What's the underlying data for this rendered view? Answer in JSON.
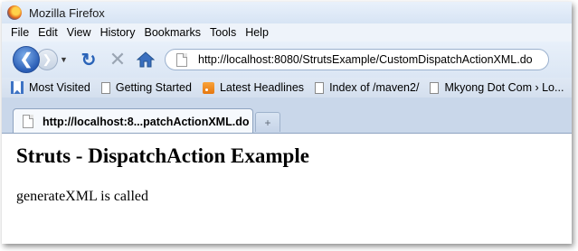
{
  "window": {
    "title": "Mozilla Firefox"
  },
  "menu": [
    "File",
    "Edit",
    "View",
    "History",
    "Bookmarks",
    "Tools",
    "Help"
  ],
  "navigation": {
    "url": "http://localhost:8080/StrutsExample/CustomDispatchActionXML.do"
  },
  "bookmarks": {
    "items": [
      {
        "label": "Most Visited",
        "icon": "bookmark-star-icon"
      },
      {
        "label": "Getting Started",
        "icon": "page-icon"
      },
      {
        "label": "Latest Headlines",
        "icon": "rss-feed-icon"
      },
      {
        "label": "Index of /maven2/",
        "icon": "page-icon"
      },
      {
        "label": "Mkyong Dot Com › Lo...",
        "icon": "page-icon"
      }
    ]
  },
  "tabs": {
    "active_title": "http://localhost:8...patchActionXML.do",
    "new_tab_label": "+"
  },
  "page": {
    "heading": "Struts - DispatchAction Example",
    "message": "generateXML is called"
  },
  "colors": {
    "accent": "#2a5db5",
    "chrome": "#dbe6f4"
  }
}
